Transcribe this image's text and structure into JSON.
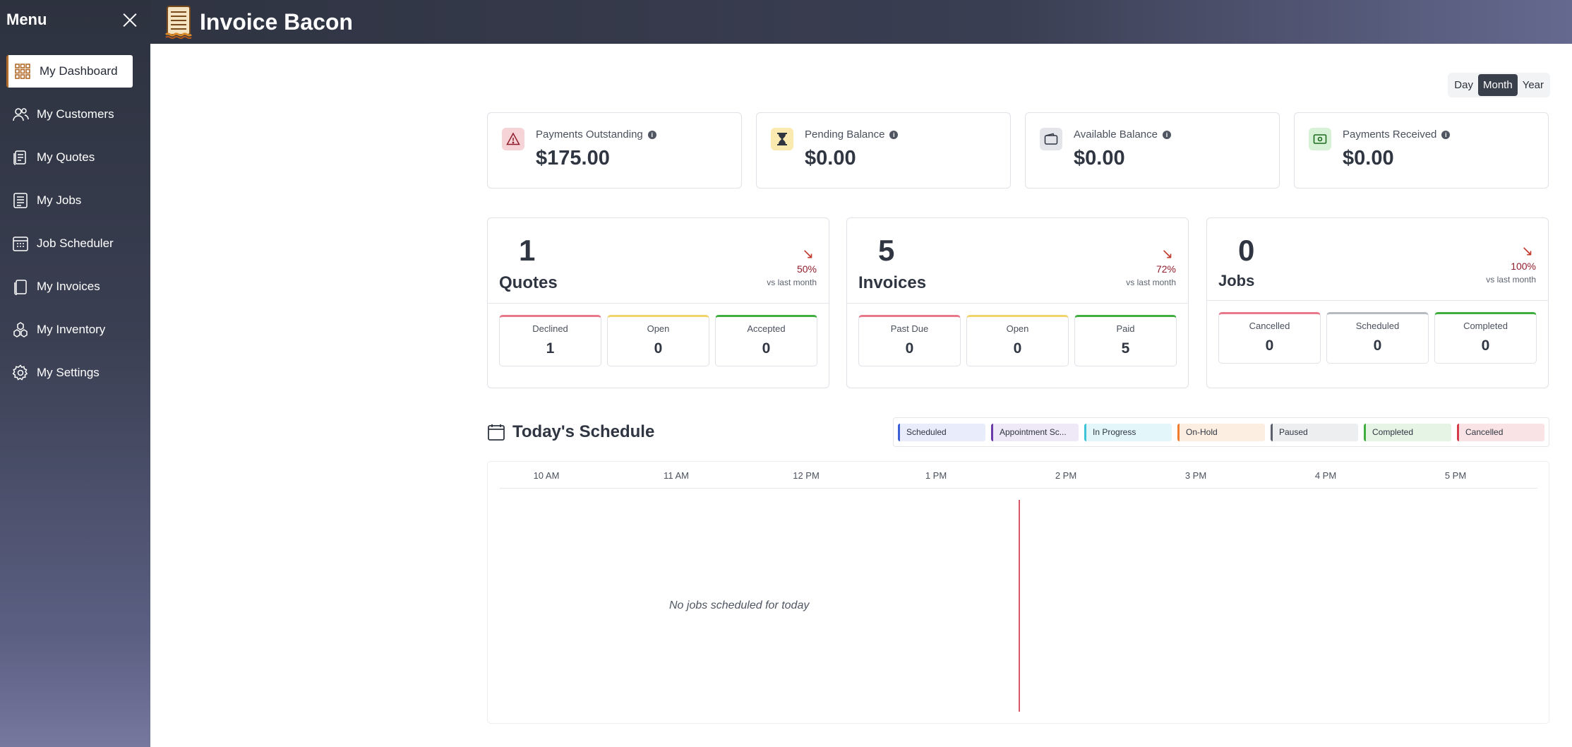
{
  "sidebar": {
    "title": "Menu",
    "items": [
      {
        "label": "My Dashboard",
        "icon": "grid-icon"
      },
      {
        "label": "My Customers",
        "icon": "users-icon"
      },
      {
        "label": "My Quotes",
        "icon": "quotes-icon"
      },
      {
        "label": "My Jobs",
        "icon": "jobs-icon"
      },
      {
        "label": "Job Scheduler",
        "icon": "calendar-icon"
      },
      {
        "label": "My Invoices",
        "icon": "invoice-icon"
      },
      {
        "label": "My Inventory",
        "icon": "inventory-icon"
      },
      {
        "label": "My Settings",
        "icon": "gear-icon"
      }
    ]
  },
  "header": {
    "brand": "Invoice Bacon"
  },
  "range": {
    "options": [
      "Day",
      "Month",
      "Year"
    ],
    "selected": "Month"
  },
  "balances": [
    {
      "label": "Payments Outstanding",
      "value": "$175.00",
      "icon": "warning-icon",
      "color": "#f6d3d6"
    },
    {
      "label": "Pending Balance",
      "value": "$0.00",
      "icon": "hourglass-icon",
      "color": "#fbeab0"
    },
    {
      "label": "Available Balance",
      "value": "$0.00",
      "icon": "wallet-icon",
      "color": "#e3e5ea"
    },
    {
      "label": "Payments Received",
      "value": "$0.00",
      "icon": "cash-icon",
      "color": "#d7f2d7"
    }
  ],
  "stats": {
    "quotes": {
      "count": "1",
      "title": "Quotes",
      "pct": "50%",
      "sub": "vs last month",
      "items": [
        {
          "label": "Declined",
          "value": "1"
        },
        {
          "label": "Open",
          "value": "0"
        },
        {
          "label": "Accepted",
          "value": "0"
        }
      ]
    },
    "invoices": {
      "count": "5",
      "title": "Invoices",
      "pct": "72%",
      "sub": "vs last month",
      "items": [
        {
          "label": "Past Due",
          "value": "0"
        },
        {
          "label": "Open",
          "value": "0"
        },
        {
          "label": "Paid",
          "value": "5"
        }
      ]
    },
    "jobs": {
      "count": "0",
      "title": "Jobs",
      "pct": "100%",
      "sub": "vs last month",
      "items": [
        {
          "label": "Cancelled",
          "value": "0"
        },
        {
          "label": "Scheduled",
          "value": "0"
        },
        {
          "label": "Completed",
          "value": "0"
        }
      ]
    }
  },
  "schedule": {
    "title": "Today's Schedule",
    "legend": [
      {
        "label": "Scheduled",
        "color": "#3c5fd6",
        "bg": "#e8ecfb"
      },
      {
        "label": "Appointment Sc...",
        "color": "#6a3aa8",
        "bg": "#efe8f7"
      },
      {
        "label": "In Progress",
        "color": "#3fc3d6",
        "bg": "#e3f6fa"
      },
      {
        "label": "On-Hold",
        "color": "#ef7d2d",
        "bg": "#fdeee2"
      },
      {
        "label": "Paused",
        "color": "#5a5f6b",
        "bg": "#eceef0"
      },
      {
        "label": "Completed",
        "color": "#3fae3f",
        "bg": "#e5f4e5"
      },
      {
        "label": "Cancelled",
        "color": "#d53c4a",
        "bg": "#f9e3e5"
      }
    ],
    "times": [
      "10 AM",
      "11 AM",
      "12 PM",
      "1 PM",
      "2 PM",
      "3 PM",
      "4 PM",
      "5 PM"
    ],
    "empty": "No jobs scheduled for today"
  }
}
